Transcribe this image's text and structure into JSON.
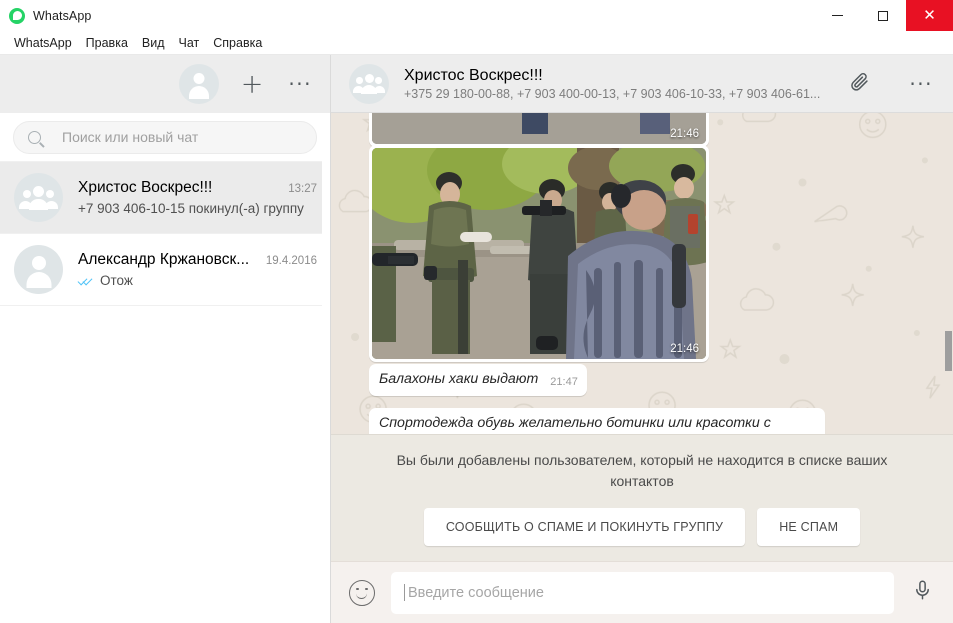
{
  "window": {
    "app_title": "WhatsApp",
    "brand_color": "#25d366",
    "close_color": "#e81123",
    "controls": {
      "minimize": "minimize-button",
      "maximize": "maximize-button",
      "close": "close-button"
    }
  },
  "menubar": {
    "items": [
      {
        "label": "WhatsApp"
      },
      {
        "label": "Правка"
      },
      {
        "label": "Вид"
      },
      {
        "label": "Чат"
      },
      {
        "label": "Справка"
      }
    ]
  },
  "sidebar": {
    "header": {
      "profile_avatar": "profile-avatar",
      "new_chat_label": "+",
      "menu_label": "···"
    },
    "search": {
      "placeholder": "Поиск или новый чат",
      "value": ""
    },
    "chats": [
      {
        "name": "Христос Воскрес!!!",
        "time": "13:27",
        "snippet": "+7 903 406-10-15 покинул(-а) группу",
        "avatar_type": "group",
        "active": true,
        "ticks": false
      },
      {
        "name": "Александр Кржановск...",
        "time": "19.4.2016",
        "snippet": "Отож",
        "avatar_type": "single",
        "active": false,
        "ticks": true,
        "tick_color": "#4fc3f7"
      }
    ]
  },
  "conversation": {
    "header": {
      "title": "Христос Воскрес!!!",
      "participants": "+375 29 180-00-88, +7 903 400-00-13, +7 903 406-10-33, +7 903 406-61...",
      "attach_icon": "paperclip-icon",
      "menu_label": "···"
    },
    "messages": [
      {
        "type": "image",
        "time": "21:46",
        "clipped": true
      },
      {
        "type": "image",
        "time": "21:46",
        "clipped": false
      },
      {
        "type": "text",
        "text": "Балахоны хаки выдают",
        "time": "21:47"
      },
      {
        "type": "text",
        "text": "Спортодежда обувь желательно ботинки или красотки с твердой подошвой (условия болоче)",
        "time": ""
      }
    ],
    "spam_banner": {
      "message": "Вы были добавлены пользователем, который не находится в списке ваших контактов",
      "report_button": "СООБЩИТЬ О СПАМЕ И ПОКИНУТЬ ГРУППУ",
      "not_spam_button": "НЕ СПАМ"
    },
    "composer": {
      "emoji_icon": "smiley-icon",
      "placeholder": "Введите сообщение",
      "value": "",
      "mic_icon": "microphone-icon"
    }
  }
}
